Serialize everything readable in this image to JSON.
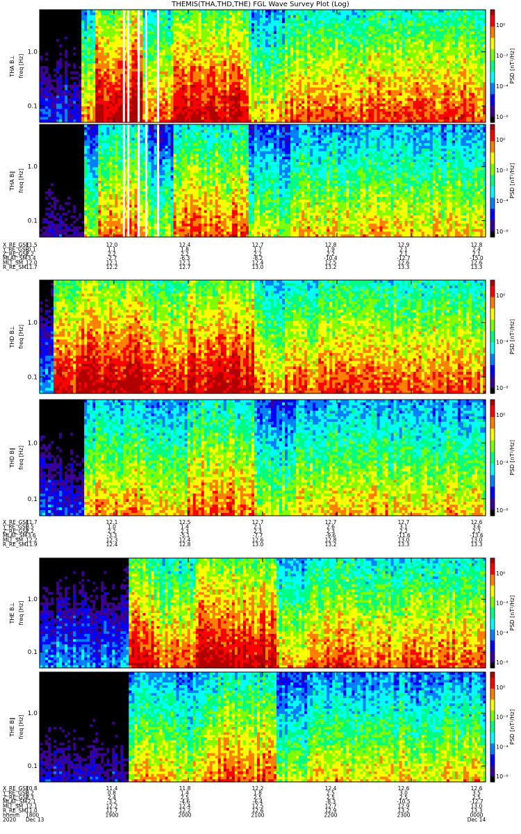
{
  "title": "THEMIS(THA,THD,THE) FGL Wave Survey Plot (Log)",
  "colors": {
    "colormap": [
      "#000000",
      "#3c0090",
      "#0000ff",
      "#0080ff",
      "#00ffff",
      "#00ff80",
      "#80ff00",
      "#ffff00",
      "#ff8000",
      "#ff0000",
      "#b00000"
    ],
    "frame": "#000000",
    "background": "#ffffff"
  },
  "chart_data": {
    "type": "heatmap",
    "x_range_hours": [
      18.0,
      24.0
    ],
    "freq_ylim_hz": [
      0.05,
      6.0
    ],
    "y_scale": "log",
    "freq_ticks": [
      "1.0",
      "0.1"
    ],
    "colorbar_scale": "log",
    "colorbar_label": "PSD [nT²/Hz]",
    "panels": [
      {
        "label": "THA B⊥",
        "ylabel": "freq [Hz]",
        "colorbar_ticks": [
          "10⁰",
          "10⁻²",
          "10⁻⁴",
          "10⁻⁶"
        ],
        "bands": [
          [
            18.0,
            18.55,
            -0.9
          ],
          [
            18.55,
            18.75,
            0.35
          ],
          [
            18.75,
            19.4,
            1.0
          ],
          [
            19.4,
            19.8,
            0.55
          ],
          [
            19.8,
            20.8,
            0.85
          ],
          [
            20.8,
            21.3,
            0.3
          ],
          [
            21.3,
            24.0,
            0.6
          ]
        ],
        "gaps": [
          19.12,
          19.18,
          19.32,
          19.42,
          19.58
        ]
      },
      {
        "label": "THA B∥",
        "ylabel": "freq [Hz]",
        "colorbar_ticks": [
          "10⁰",
          "10⁻²",
          "10⁻⁴",
          "10⁻⁶"
        ],
        "bands": [
          [
            18.0,
            18.6,
            -1.2
          ],
          [
            18.6,
            18.8,
            0.1
          ],
          [
            18.8,
            19.45,
            0.5
          ],
          [
            19.45,
            19.8,
            0.0
          ],
          [
            19.8,
            20.8,
            0.55
          ],
          [
            20.8,
            21.4,
            0.1
          ],
          [
            21.4,
            24.0,
            0.3
          ]
        ],
        "gaps": [
          19.12,
          19.18,
          19.32,
          19.42,
          19.58
        ]
      },
      {
        "label": "THD B⊥",
        "ylabel": "freq [Hz]",
        "colorbar_ticks": [
          "10⁰",
          "10⁻⁴",
          "10⁻⁸"
        ],
        "bands": [
          [
            18.0,
            18.2,
            -0.6
          ],
          [
            18.2,
            18.5,
            0.7
          ],
          [
            18.5,
            19.5,
            0.95
          ],
          [
            19.5,
            20.0,
            0.7
          ],
          [
            20.0,
            20.9,
            0.9
          ],
          [
            20.9,
            21.3,
            0.45
          ],
          [
            21.3,
            24.0,
            0.6
          ]
        ],
        "gaps": []
      },
      {
        "label": "THD B∥",
        "ylabel": "freq [Hz]",
        "colorbar_ticks": [
          "10⁰",
          "10⁻⁴",
          "10⁻⁸"
        ],
        "bands": [
          [
            18.0,
            18.6,
            -0.9
          ],
          [
            18.6,
            19.4,
            0.4
          ],
          [
            19.4,
            20.0,
            0.25
          ],
          [
            20.0,
            20.9,
            0.55
          ],
          [
            20.9,
            21.4,
            0.1
          ],
          [
            21.4,
            24.0,
            0.3
          ]
        ],
        "gaps": []
      },
      {
        "label": "THE B⊥",
        "ylabel": "freq [Hz]",
        "colorbar_ticks": [
          "10⁰",
          "10⁻²",
          "10⁻⁴",
          "10⁻⁶"
        ],
        "bands": [
          [
            18.0,
            19.2,
            -0.7
          ],
          [
            19.2,
            19.6,
            0.75
          ],
          [
            19.6,
            20.1,
            0.55
          ],
          [
            20.1,
            21.2,
            0.9
          ],
          [
            21.2,
            21.6,
            0.35
          ],
          [
            21.6,
            24.0,
            0.55
          ]
        ],
        "gaps": []
      },
      {
        "label": "THE B∥",
        "ylabel": "freq [Hz]",
        "colorbar_ticks": [
          "10⁰",
          "10⁻²",
          "10⁻⁴",
          "10⁻⁶"
        ],
        "bands": [
          [
            18.0,
            19.2,
            -1.1
          ],
          [
            19.2,
            19.7,
            0.3
          ],
          [
            19.7,
            20.2,
            0.2
          ],
          [
            20.2,
            21.2,
            0.55
          ],
          [
            21.2,
            21.6,
            0.05
          ],
          [
            21.6,
            24.0,
            0.25
          ]
        ],
        "gaps": []
      }
    ],
    "ephemeris_blocks": [
      {
        "probe": "THA",
        "rows": [
          {
            "label": "X_RE_GSE",
            "values": [
              "11.5",
              "12.0",
              "12.4",
              "12.7",
              "12.8",
              "12.9",
              "12.8"
            ]
          },
          {
            "label": "Y_RE_GSE",
            "values": [
              "-0.1",
              "1.1",
              "1.8",
              "1.7",
              "1.9",
              "2.1",
              "2.4"
            ]
          },
          {
            "label": "Z_RE_GSE",
            "values": [
              "2.2",
              "2.2",
              "2.2",
              "2.2",
              "2.2",
              "2.1",
              "2.1"
            ]
          },
          {
            "label": "MLAT_SM",
            "values": [
              "-3.4",
              "-2.7",
              "-6.3",
              "-8.2",
              "-10.4",
              "-12.7",
              "-15.0"
            ]
          },
          {
            "label": "MLT_SM",
            "values": [
              "12.0",
              "12.1",
              "12.1",
              "12.4",
              "12.5",
              "12.6",
              "12.6"
            ]
          },
          {
            "label": "R_RE_SM",
            "values": [
              "11.7",
              "12.2",
              "12.7",
              "13.0",
              "13.2",
              "13.3",
              "13.3"
            ]
          }
        ]
      },
      {
        "probe": "THD",
        "rows": [
          {
            "label": "X_RE_GSE",
            "values": [
              "11.7",
              "12.1",
              "12.5",
              "12.7",
              "12.7",
              "12.7",
              "12.6"
            ]
          },
          {
            "label": "Y_RE_GSE",
            "values": [
              "0.5",
              "1.0",
              "1.4",
              "2.1",
              "2.6",
              "3.1",
              "3.6"
            ]
          },
          {
            "label": "Z_RE_GSE",
            "values": [
              "2.2",
              "2.2",
              "2.3",
              "2.3",
              "2.3",
              "2.2",
              "2.2"
            ]
          },
          {
            "label": "MLAT_SM",
            "values": [
              "-3.6",
              "-3.3",
              "-5.1",
              "-7.7",
              "-9.6",
              "-11.6",
              "-13.6"
            ]
          },
          {
            "label": "MLT_SM",
            "values": [
              "12.2",
              "12.3",
              "12.4",
              "12.6",
              "12.8",
              "13.0",
              "13.0"
            ]
          },
          {
            "label": "R_RE_SM",
            "values": [
              "11.9",
              "12.4",
              "12.8",
              "13.0",
              "13.2",
              "13.3",
              "13.3"
            ]
          }
        ]
      },
      {
        "probe": "THE",
        "rows": [
          {
            "label": "X_RE_GSE",
            "values": [
              "10.8",
              "11.4",
              "11.8",
              "12.2",
              "12.4",
              "12.6",
              "12.6"
            ]
          },
          {
            "label": "Y_RE_GSE",
            "values": [
              "0.2",
              "0.8",
              "1.4",
              "1.8",
              "2.5",
              "3.0",
              "3.5"
            ]
          },
          {
            "label": "Z_RE_GSE",
            "values": [
              "2.3",
              "2.4",
              "2.5",
              "2.5",
              "2.5",
              "2.5",
              "2.5"
            ]
          },
          {
            "label": "MLAT_SM",
            "values": [
              "-2.1",
              "-3.2",
              "-4.6",
              "-6.4",
              "-8.3",
              "-10.5",
              "-12.7"
            ]
          },
          {
            "label": "MLT_SM",
            "values": [
              "12.1",
              "12.2",
              "12.4",
              "12.5",
              "12.7",
              "12.9",
              "13.0"
            ]
          },
          {
            "label": "R_RE_SM",
            "values": [
              "11.0",
              "11.7",
              "12.2",
              "12.6",
              "12.9",
              "13.2",
              "13.3"
            ]
          },
          {
            "label": "hhmm",
            "values": [
              "1800",
              "1900",
              "2000",
              "2100",
              "2200",
              "2300",
              "0000"
            ]
          },
          {
            "label": "2020",
            "values": [
              "Dec 13",
              "",
              "",
              "",
              "",
              "",
              "Dec 14"
            ]
          }
        ]
      }
    ]
  }
}
